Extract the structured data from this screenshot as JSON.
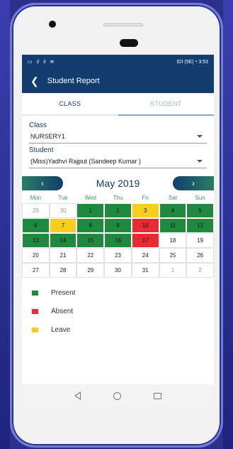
{
  "status_bar": {
    "left": [
      "▭",
      "ıl",
      "ıl",
      "≋"
    ],
    "right": "IDI (5E) ⁴ 3:53"
  },
  "app": {
    "title": "Student Report",
    "back_icon": "arrow-left-icon"
  },
  "tabs": [
    {
      "label": "CLASS",
      "active": true
    },
    {
      "label": "STUDENT",
      "active": false
    }
  ],
  "form": {
    "class_label": "Class",
    "class_value": "NURSERY1",
    "student_label": "Student",
    "student_value": "(Miss)Yadhvi  Rajput (Sandeep Kumar )"
  },
  "calendar": {
    "month_title": "May 2019",
    "prev_label": "‹",
    "next_label": "›",
    "weekdays": [
      "Mon",
      "Tue",
      "Wed",
      "Thu",
      "Fri",
      "Sat",
      "Sun"
    ],
    "days": [
      {
        "n": "29",
        "s": "other"
      },
      {
        "n": "30",
        "s": "other"
      },
      {
        "n": "1",
        "s": "present"
      },
      {
        "n": "2",
        "s": "present"
      },
      {
        "n": "3",
        "s": "leave"
      },
      {
        "n": "4",
        "s": "present"
      },
      {
        "n": "5",
        "s": "present"
      },
      {
        "n": "6",
        "s": "present"
      },
      {
        "n": "7",
        "s": "leave"
      },
      {
        "n": "8",
        "s": "present"
      },
      {
        "n": "9",
        "s": "present"
      },
      {
        "n": "10",
        "s": "absent"
      },
      {
        "n": "11",
        "s": "present"
      },
      {
        "n": "12",
        "s": "present"
      },
      {
        "n": "13",
        "s": "present"
      },
      {
        "n": "14",
        "s": "present"
      },
      {
        "n": "15",
        "s": "present"
      },
      {
        "n": "16",
        "s": "present"
      },
      {
        "n": "17",
        "s": "absent"
      },
      {
        "n": "18",
        "s": ""
      },
      {
        "n": "19",
        "s": ""
      },
      {
        "n": "20",
        "s": ""
      },
      {
        "n": "21",
        "s": ""
      },
      {
        "n": "22",
        "s": ""
      },
      {
        "n": "23",
        "s": ""
      },
      {
        "n": "24",
        "s": ""
      },
      {
        "n": "25",
        "s": ""
      },
      {
        "n": "26",
        "s": ""
      },
      {
        "n": "27",
        "s": ""
      },
      {
        "n": "28",
        "s": ""
      },
      {
        "n": "29",
        "s": ""
      },
      {
        "n": "30",
        "s": ""
      },
      {
        "n": "31",
        "s": ""
      },
      {
        "n": "1",
        "s": "other"
      },
      {
        "n": "2",
        "s": "other"
      }
    ]
  },
  "legend": [
    {
      "label": "Present",
      "color": "#1f8a3f"
    },
    {
      "label": "Absent",
      "color": "#ea2a33"
    },
    {
      "label": "Leave",
      "color": "#f5cf1c"
    }
  ],
  "colors": {
    "primary": "#123d6e",
    "accent": "#3b9a5e"
  }
}
